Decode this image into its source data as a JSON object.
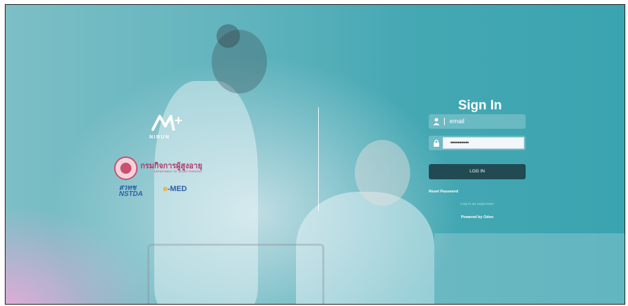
{
  "branding": {
    "nirun_name": "NIRUN",
    "department_thai": "กรมกิจการผู้สูงอายุ",
    "department_english": "DEPARTMENT OF OLDER PERSONS",
    "nstda_thai": "สวทช",
    "nstda_name": "NSTDA",
    "emed_dot": "e",
    "emed_name": "-MED"
  },
  "login": {
    "title": "Sign In",
    "email_placeholder": "email",
    "password_value": "••••••••••",
    "login_button": "LOG IN",
    "reset_password": "Reset Password",
    "superuser_link": "Log in as superuser",
    "powered_by": "Powered by Odoo"
  },
  "icons": {
    "user": "user-icon",
    "lock": "lock-icon"
  },
  "colors": {
    "teal_background": "#45a8b3",
    "pink_gradient": "#e6aad7",
    "login_button": "#214a52",
    "department_magenta": "#b2386a",
    "nstda_blue": "#2d5fa8"
  }
}
